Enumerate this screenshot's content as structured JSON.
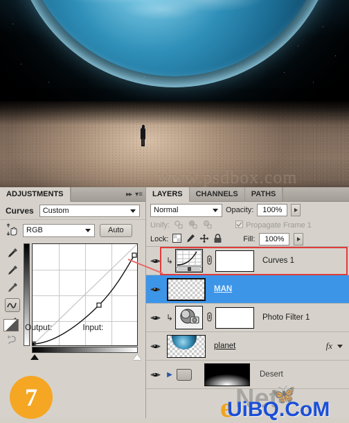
{
  "canvas": {
    "watermark": "www.psdbox.com",
    "scene_elements": [
      "planet",
      "stars",
      "desert-ground",
      "standing-man"
    ]
  },
  "adjustments": {
    "tab_label": "ADJUSTMENTS",
    "collapse_icon": "▸▸",
    "menu_icon": "▾≡",
    "title": "Curves",
    "preset_value": "Custom",
    "channel_value": "RGB",
    "auto_label": "Auto",
    "output_label": "Output:",
    "input_label": "Input:",
    "step_number": "7",
    "tools": [
      "targeted-adjustment-hand",
      "eyedropper-black",
      "eyedropper-gray",
      "eyedropper-white",
      "curve-pencil-point",
      "curve-draw-pencil",
      "smooth-curve"
    ]
  },
  "chart_data": {
    "type": "line",
    "title": "Curves",
    "xlabel": "Input",
    "ylabel": "Output",
    "xlim": [
      0,
      255
    ],
    "ylim": [
      0,
      255
    ],
    "grid": true,
    "series": [
      {
        "name": "RGB curve",
        "points": [
          [
            0,
            0
          ],
          [
            163,
            102
          ],
          [
            250,
            224
          ]
        ],
        "control_points": [
          [
            0,
            0
          ],
          [
            163,
            102
          ],
          [
            250,
            224
          ]
        ]
      },
      {
        "name": "baseline identity",
        "points": [
          [
            0,
            0
          ],
          [
            255,
            255
          ]
        ]
      }
    ]
  },
  "layers": {
    "tabs": [
      {
        "label": "LAYERS",
        "active": true
      },
      {
        "label": "CHANNELS",
        "active": false
      },
      {
        "label": "PATHS",
        "active": false
      }
    ],
    "collapse_icon": "▸▸",
    "menu_icon": "▾≡",
    "blend_mode": "Normal",
    "opacity_label": "Opacity:",
    "opacity_value": "100%",
    "unify_label": "Unify:",
    "propagate_label": "Propagate Frame 1",
    "lock_label": "Lock:",
    "fill_label": "Fill:",
    "fill_value": "100%",
    "lock_icons": [
      "lock-transparency-icon",
      "lock-image-icon",
      "lock-position-icon",
      "lock-all-icon"
    ],
    "unify_icons": [
      "unify-position-icon",
      "unify-visibility-icon",
      "unify-style-icon"
    ],
    "rows": [
      {
        "name": "Curves 1",
        "type": "adjustment",
        "clipped": true,
        "selected": false,
        "has_mask": true,
        "thumb": "curves-adjustment-icon",
        "has_fx": false,
        "highlighted": true
      },
      {
        "name": "MAN",
        "type": "pixel",
        "clipped": false,
        "selected": true,
        "has_mask": false,
        "thumb": "transparent-thumb",
        "has_fx": false,
        "highlighted": false
      },
      {
        "name": "Photo Filter 1",
        "type": "adjustment",
        "clipped": true,
        "selected": false,
        "has_mask": true,
        "thumb": "photo-filter-icon",
        "has_fx": false,
        "highlighted": false
      },
      {
        "name": "planet",
        "type": "pixel",
        "clipped": false,
        "selected": false,
        "has_mask": false,
        "thumb": "planet-thumb",
        "has_fx": true,
        "highlighted": false
      },
      {
        "name": "Desert",
        "type": "group",
        "clipped": false,
        "selected": false,
        "has_mask": true,
        "thumb": "folder-icon",
        "has_fx": false,
        "highlighted": false
      }
    ],
    "fx_label": "fx"
  },
  "site_watermark": {
    "e_mark": "e",
    "net_mark": "Net",
    "uibq_mark": "UiBQ.CoM"
  },
  "colors": {
    "selection_blue": "#3d95e8",
    "annotation_red": "#e03b3b",
    "badge_orange": "#f5a623",
    "panel_gray": "#d6d2cb"
  }
}
